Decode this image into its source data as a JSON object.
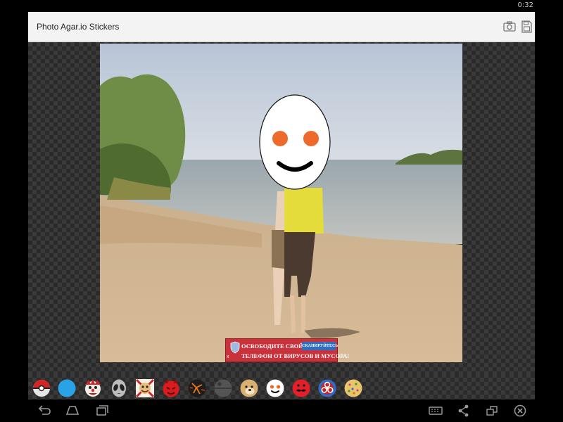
{
  "status_bar": {
    "time": "0:32"
  },
  "app": {
    "title": "Photo Agar.io Stickers",
    "actions": [
      {
        "name": "camera-button",
        "icon": "camera-icon"
      },
      {
        "name": "save-button",
        "icon": "floppy-disk-icon"
      }
    ]
  },
  "ad": {
    "line1": "ОСВОБОДИТЕ СВОЙ",
    "line2": "ТЕЛЕФОН ОТ ВИРУСОВ И МУСОРА!",
    "cta": "СКАНИРУЙТЕСЬ",
    "close": "x"
  },
  "stickers": [
    {
      "name": "pokeball",
      "icon": "pokeball-icon"
    },
    {
      "name": "blue-cell",
      "icon": "blue-circle-icon"
    },
    {
      "name": "clown",
      "icon": "clown-face-icon"
    },
    {
      "name": "alien",
      "icon": "alien-face-icon"
    },
    {
      "name": "bowser",
      "icon": "bowser-face-icon"
    },
    {
      "name": "red-devil",
      "icon": "red-devil-icon"
    },
    {
      "name": "lava",
      "icon": "lava-ball-icon"
    },
    {
      "name": "death-star",
      "icon": "death-star-icon"
    },
    {
      "name": "doge",
      "icon": "doge-face-icon"
    },
    {
      "name": "smiley",
      "icon": "smiley-face-icon"
    },
    {
      "name": "mustache",
      "icon": "mustache-face-icon"
    },
    {
      "name": "biohazard",
      "icon": "biohazard-icon"
    },
    {
      "name": "cookie",
      "icon": "cookie-icon"
    }
  ],
  "nav": [
    {
      "name": "back-button",
      "icon": "back-icon"
    },
    {
      "name": "home-button",
      "icon": "home-icon"
    },
    {
      "name": "recents-button",
      "icon": "recent-apps-icon"
    },
    {
      "name": "keyboard-button",
      "icon": "keyboard-icon"
    },
    {
      "name": "share-button",
      "icon": "share-icon"
    },
    {
      "name": "window-button",
      "icon": "window-resize-icon"
    },
    {
      "name": "exit-button",
      "icon": "close-circle-icon"
    }
  ],
  "colors": {
    "action_bar": "#f3f3f3",
    "ad_red": "#c9313b",
    "ad_button": "#2f6fc2",
    "smiley_eyes": "#ee6a2c"
  }
}
